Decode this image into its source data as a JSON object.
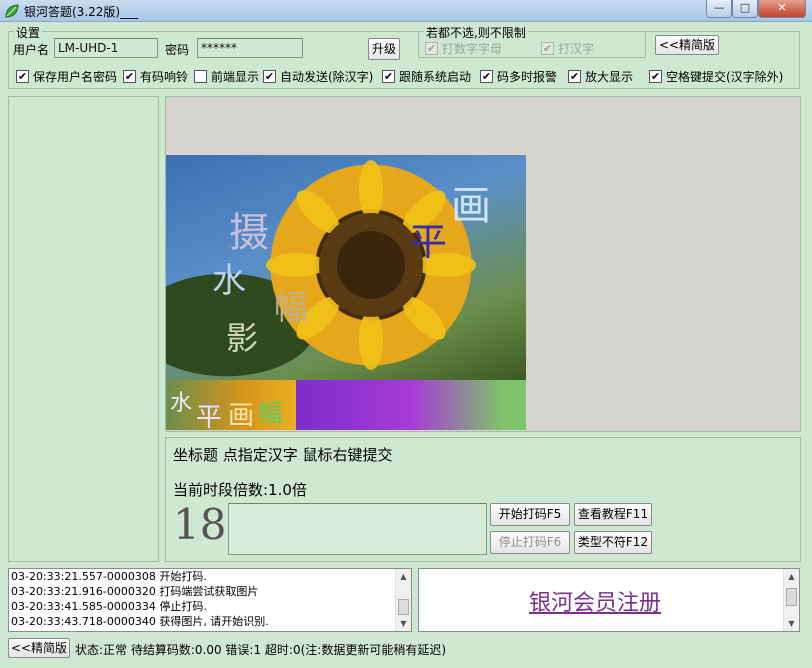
{
  "window": {
    "title": "银河答题(3.22版)___",
    "min": "—",
    "max": "□",
    "close": "✕"
  },
  "settings": {
    "group_label": "设置",
    "username_label": "用户名",
    "username_value": "LM-UHD-1",
    "password_label": "密码",
    "password_value": "******",
    "upgrade_label": "升级"
  },
  "filter": {
    "group_label": "若都不选,则不限制",
    "options": [
      {
        "label": "打数字字母",
        "checked": true
      },
      {
        "label": "打汉字",
        "checked": true
      }
    ]
  },
  "compact_button": "<<精简版",
  "options": [
    {
      "label": "保存用户名密码",
      "checked": true
    },
    {
      "label": "有码响铃",
      "checked": true
    },
    {
      "label": "前端显示",
      "checked": false
    },
    {
      "label": "自动发送(除汉字)",
      "checked": true
    },
    {
      "label": "跟随系统启动",
      "checked": true
    },
    {
      "label": "码多时报警",
      "checked": true
    },
    {
      "label": "放大显示",
      "checked": true
    },
    {
      "label": "空格键提交(汉字除外)",
      "checked": true
    }
  ],
  "captcha": {
    "glyphs": [
      "画",
      "摄",
      "平",
      "水",
      "幅",
      "影",
      "水",
      "平",
      "画",
      "幅"
    ]
  },
  "task": {
    "instruction": "坐标题 点指定汉字 鼠标右键提交",
    "multiplier": "当前时段倍数:1.0倍",
    "countdown": "18",
    "answer_value": ""
  },
  "buttons": {
    "start": "开始打码F5",
    "tutorial": "查看教程F11",
    "stop": "停止打码F6",
    "mismatch": "类型不符F12"
  },
  "log": [
    "03-20:33:21.557-0000308  开始打码.",
    "03-20:33:21.916-0000320  打码端尝试获取图片",
    "03-20:33:41.585-0000334  停止打码.",
    "03-20:33:43.718-0000340  获得图片, 请开始识别."
  ],
  "ad": {
    "link": "银河会员注册"
  },
  "status": {
    "compact_button": "<<精简版",
    "text": "状态:正常 待结算码数:0.00 错误:1 超时:0(注:数据更新可能稍有延迟)"
  },
  "colors": {
    "background": "#cfe8d2",
    "link": "#7a2f8d"
  }
}
